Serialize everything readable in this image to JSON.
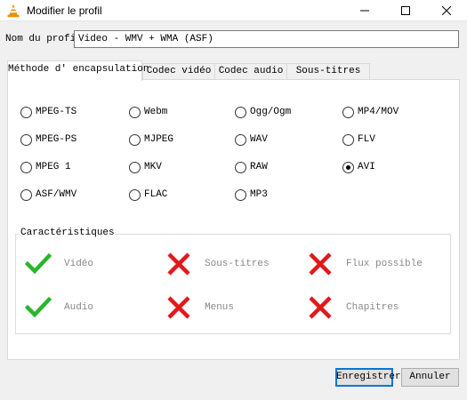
{
  "window": {
    "title": "Modifier le profil"
  },
  "profile_name": {
    "label": "Nom du profil",
    "value": "Video - WMV + WMA (ASF)"
  },
  "tabs": [
    {
      "label": "Méthode d' encapsulation",
      "active": true
    },
    {
      "label": "Codec vidéo",
      "active": false
    },
    {
      "label": "Codec audio",
      "active": false
    },
    {
      "label": "Sous-titres",
      "active": false
    }
  ],
  "encapsulation_options": [
    {
      "label": "MPEG-TS",
      "checked": false
    },
    {
      "label": "Webm",
      "checked": false
    },
    {
      "label": "Ogg/Ogm",
      "checked": false
    },
    {
      "label": "MP4/MOV",
      "checked": false
    },
    {
      "label": "MPEG-PS",
      "checked": false
    },
    {
      "label": "MJPEG",
      "checked": false
    },
    {
      "label": "WAV",
      "checked": false
    },
    {
      "label": "FLV",
      "checked": false
    },
    {
      "label": "MPEG 1",
      "checked": false
    },
    {
      "label": "MKV",
      "checked": false
    },
    {
      "label": "RAW",
      "checked": false
    },
    {
      "label": "AVI",
      "checked": true
    },
    {
      "label": "ASF/WMV",
      "checked": false
    },
    {
      "label": "FLAC",
      "checked": false
    },
    {
      "label": "MP3",
      "checked": false
    }
  ],
  "features": {
    "title": "Caractéristiques",
    "items": [
      {
        "label": "Vidéo",
        "supported": true
      },
      {
        "label": "Sous-titres",
        "supported": false
      },
      {
        "label": "Flux possible",
        "supported": false
      },
      {
        "label": "Audio",
        "supported": true
      },
      {
        "label": "Menus",
        "supported": false
      },
      {
        "label": "Chapitres",
        "supported": false
      }
    ]
  },
  "buttons": {
    "save": "Enregistrer",
    "cancel": "Annuler"
  },
  "colors": {
    "check": "#2bb52b",
    "cross": "#e0191b",
    "accent": "#0078d7",
    "vlc_orange": "#f28c00"
  },
  "icons": {
    "app": "vlc-cone-icon",
    "minimize": "minimize-icon",
    "maximize": "maximize-icon",
    "close": "close-icon",
    "supported": "checkmark-icon",
    "unsupported": "cross-icon"
  }
}
